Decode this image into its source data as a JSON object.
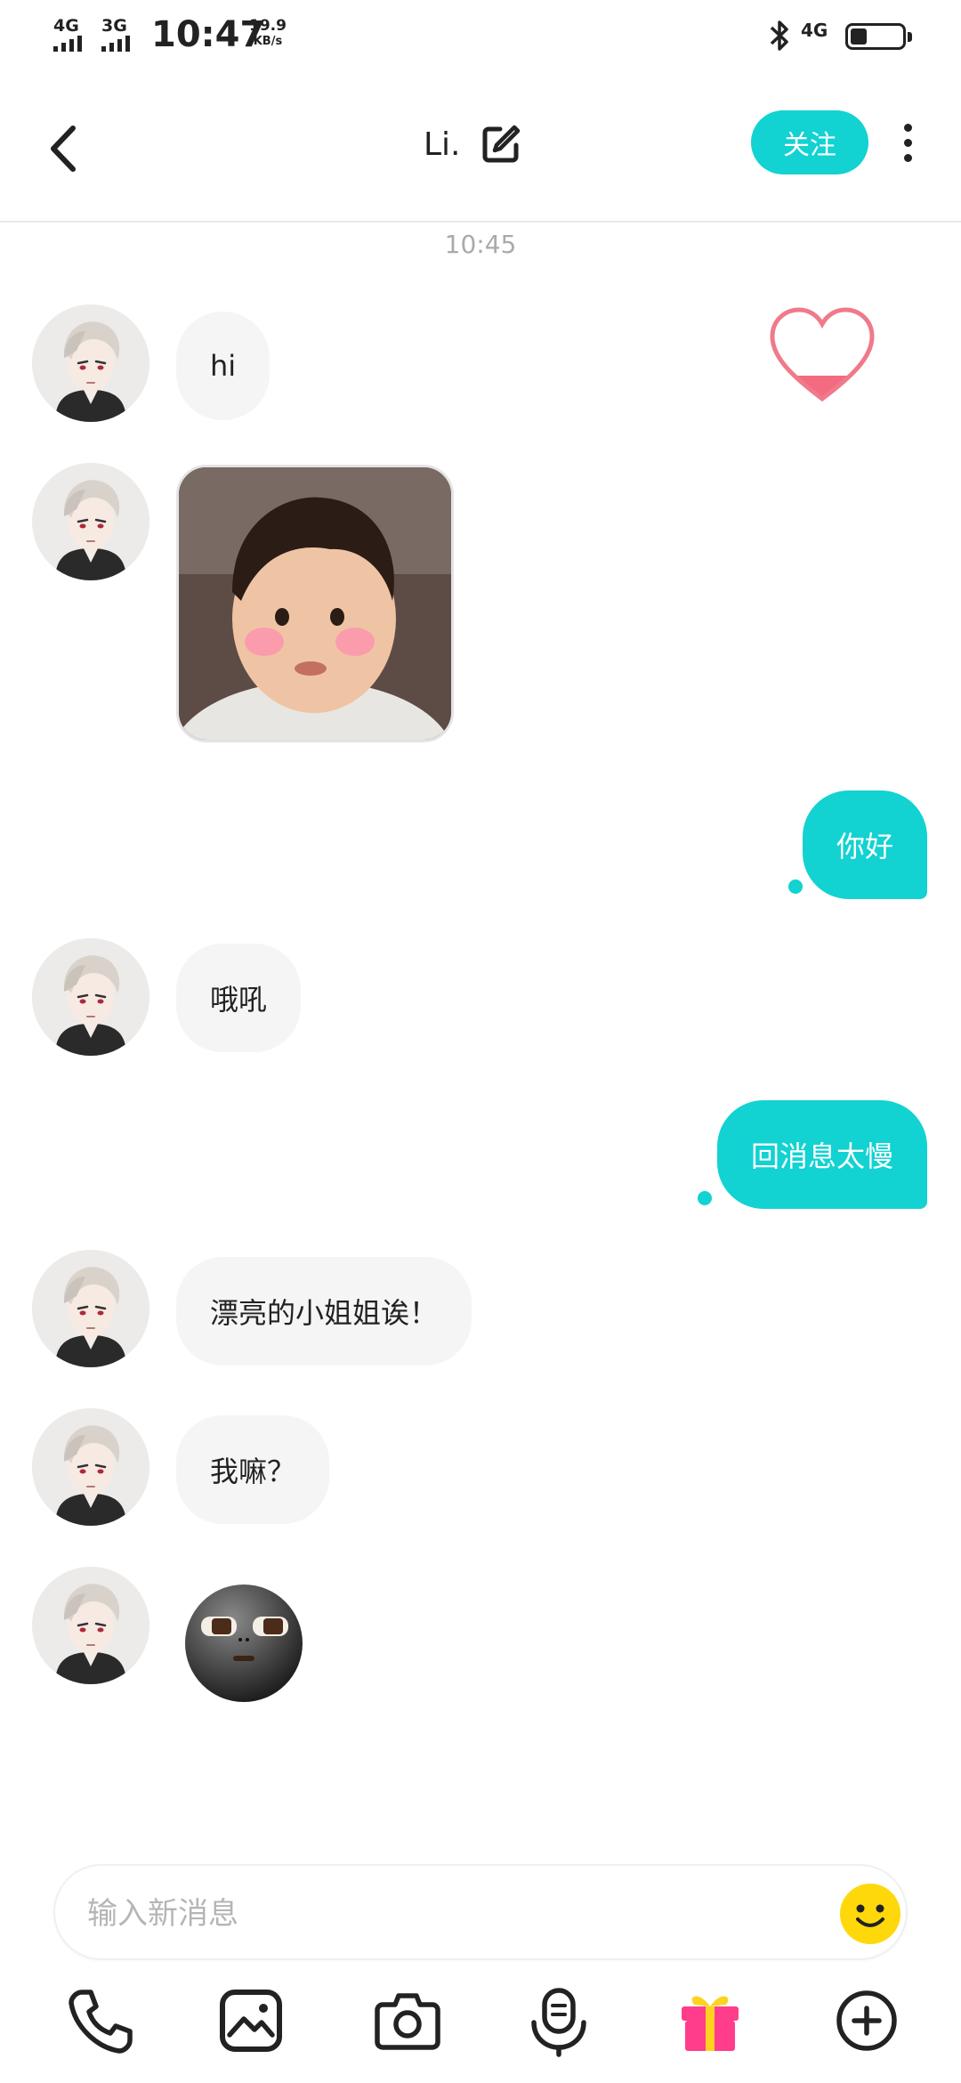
{
  "status_bar": {
    "network1": "4G",
    "network2": "3G",
    "time": "10:47",
    "speed_value": "19.9",
    "speed_unit": "KB/s",
    "network_right": "4G",
    "icons": [
      "signal-icon",
      "bluetooth-icon",
      "battery-icon"
    ]
  },
  "header": {
    "title": "Li.",
    "follow_label": "关注",
    "icons": [
      "back-arrow-icon",
      "edit-icon",
      "more-vertical-icon"
    ]
  },
  "chat": {
    "timestamp": "10:45",
    "messages": [
      {
        "side": "in",
        "type": "text",
        "text": "hi"
      },
      {
        "side": "in",
        "type": "image"
      },
      {
        "side": "out",
        "type": "text",
        "text": "你好"
      },
      {
        "side": "in",
        "type": "text",
        "text": "哦吼"
      },
      {
        "side": "out",
        "type": "text",
        "text": "回消息太慢"
      },
      {
        "side": "in",
        "type": "text",
        "text": "漂亮的小姐姐诶！"
      },
      {
        "side": "in",
        "type": "text",
        "text": "我嘛？"
      },
      {
        "side": "in",
        "type": "sticker"
      }
    ]
  },
  "input": {
    "placeholder": "输入新消息",
    "value": ""
  },
  "toolbar": {
    "items": [
      "phone-icon",
      "gallery-icon",
      "camera-icon",
      "voice-icon",
      "gift-icon",
      "add-icon"
    ]
  },
  "colors": {
    "accent": "#12d2d2",
    "incoming_bubble": "#f5f5f5",
    "heart": "#f07080",
    "gift": "#ff3d8b"
  }
}
